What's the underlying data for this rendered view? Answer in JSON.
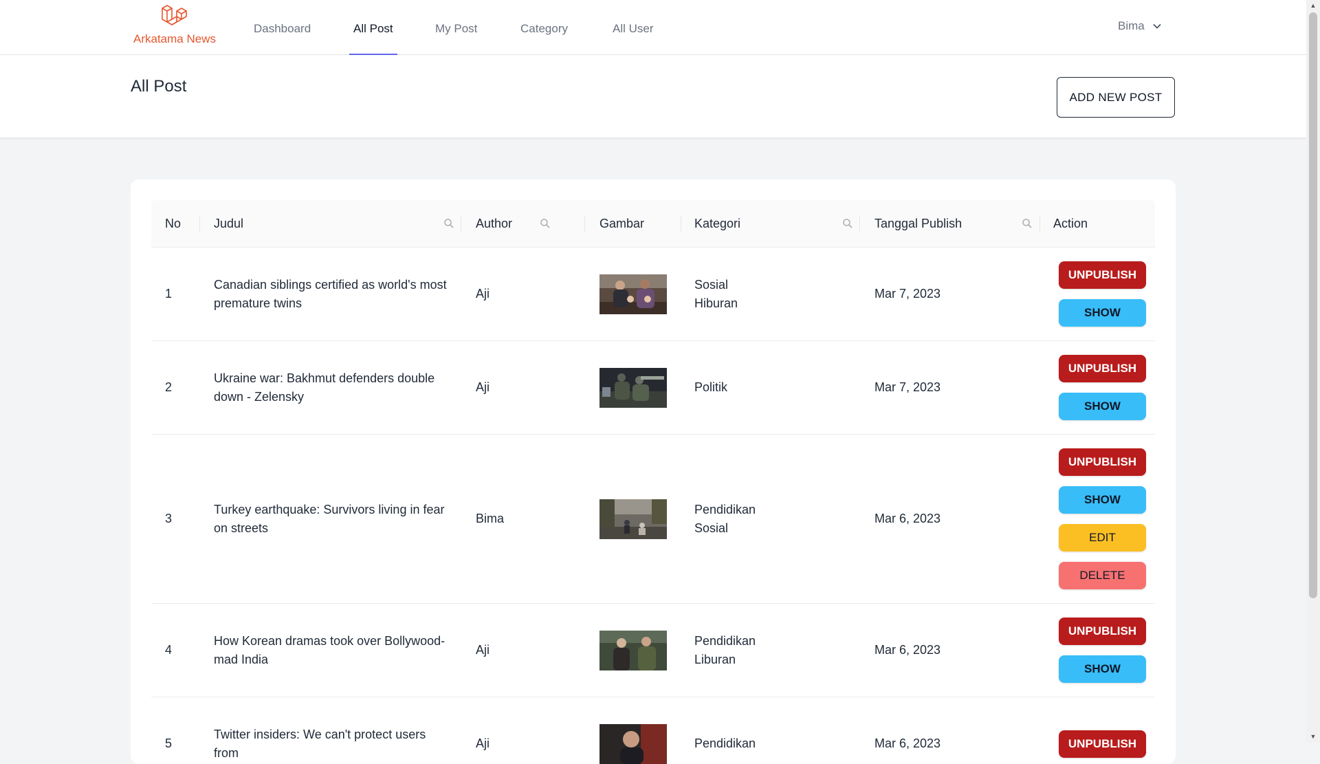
{
  "brand": {
    "name": "Arkatama News",
    "icon": "laravel-logo-icon",
    "color": "#e4572e"
  },
  "nav": {
    "items": [
      {
        "label": "Dashboard",
        "active": false
      },
      {
        "label": "All Post",
        "active": true
      },
      {
        "label": "My Post",
        "active": false
      },
      {
        "label": "Category",
        "active": false
      },
      {
        "label": "All User",
        "active": false
      }
    ],
    "user": {
      "name": "Bima",
      "icon": "chevron-down-icon"
    }
  },
  "page": {
    "title": "All Post",
    "add_button": "ADD NEW POST"
  },
  "table": {
    "columns": {
      "no": "No",
      "judul": "Judul",
      "author": "Author",
      "gambar": "Gambar",
      "kategori": "Kategori",
      "tanggal": "Tanggal Publish",
      "action": "Action"
    },
    "rows": [
      {
        "no": "1",
        "judul": "Canadian siblings certified as world's most premature twins",
        "author": "Aji",
        "image": "twins-family-photo",
        "categories": [
          "Sosial",
          "Hiburan"
        ],
        "date": "Mar 7, 2023",
        "actions": [
          "UNPUBLISH",
          "SHOW"
        ]
      },
      {
        "no": "2",
        "judul": "Ukraine war: Bakhmut defenders double down - Zelensky",
        "author": "Aji",
        "image": "soldiers-photo",
        "categories": [
          "Politik"
        ],
        "date": "Mar 7, 2023",
        "actions": [
          "UNPUBLISH",
          "SHOW"
        ]
      },
      {
        "no": "3",
        "judul": "Turkey earthquake: Survivors living in fear on streets",
        "author": "Bima",
        "image": "earthquake-street-photo",
        "categories": [
          "Pendidikan",
          "Sosial"
        ],
        "date": "Mar 6, 2023",
        "actions": [
          "UNPUBLISH",
          "SHOW",
          "EDIT",
          "DELETE"
        ]
      },
      {
        "no": "4",
        "judul": "How Korean dramas took over Bollywood-mad India",
        "author": "Aji",
        "image": "korean-drama-photo",
        "categories": [
          "Pendidikan",
          "Liburan"
        ],
        "date": "Mar 6, 2023",
        "actions": [
          "UNPUBLISH",
          "SHOW"
        ]
      },
      {
        "no": "5",
        "judul": "Twitter insiders: We can't protect users from",
        "author": "Aji",
        "image": "twitter-portrait-photo",
        "categories": [
          "Pendidikan"
        ],
        "date": "Mar 6, 2023",
        "actions": [
          "UNPUBLISH"
        ]
      }
    ]
  },
  "colors": {
    "accent": "#6366f1",
    "unpublish": "#b91c1c",
    "show": "#38bdf8",
    "edit": "#fbbf24",
    "delete": "#f87171"
  }
}
